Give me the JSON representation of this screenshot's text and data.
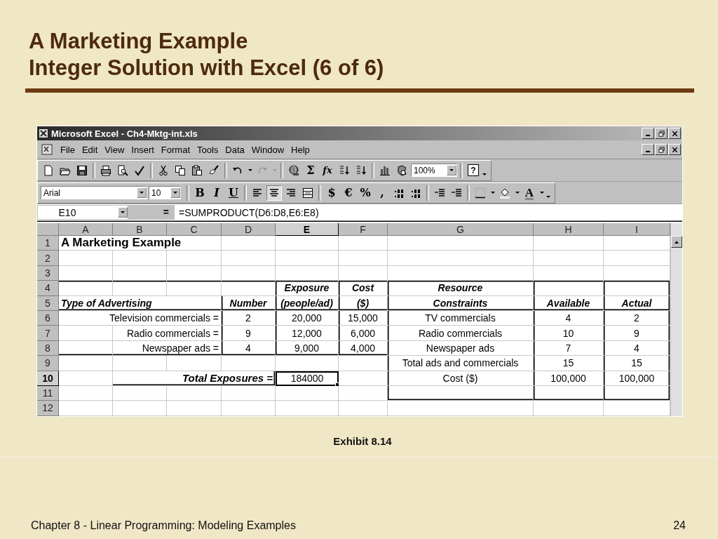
{
  "slide": {
    "title_lines": [
      "A Marketing Example",
      "Integer Solution with Excel (6 of 6)"
    ],
    "caption": "Exhibit 8.14",
    "footer": "Chapter 8 - Linear Programming:  Modeling Examples",
    "page": "24"
  },
  "window": {
    "title": "Microsoft Excel - Ch4-Mktg-int.xls"
  },
  "menu": [
    {
      "label": "File"
    },
    {
      "label": "Edit"
    },
    {
      "label": "View"
    },
    {
      "label": "Insert"
    },
    {
      "label": "Format"
    },
    {
      "label": "Tools"
    },
    {
      "label": "Data"
    },
    {
      "label": "Window"
    },
    {
      "label": "Help"
    }
  ],
  "standard_toolbar": [
    {
      "kind": "new"
    },
    {
      "kind": "open"
    },
    {
      "kind": "save"
    },
    {
      "kind": "separator"
    },
    {
      "kind": "print"
    },
    {
      "kind": "preview"
    },
    {
      "kind": "spelling"
    },
    {
      "kind": "separator"
    },
    {
      "kind": "cut"
    },
    {
      "kind": "copy"
    },
    {
      "kind": "paste"
    },
    {
      "kind": "painter"
    },
    {
      "kind": "separator"
    },
    {
      "kind": "undo"
    },
    {
      "kind": "caret"
    },
    {
      "kind": "redo"
    },
    {
      "kind": "caret-dim"
    },
    {
      "kind": "separator"
    },
    {
      "kind": "web"
    },
    {
      "kind": "glyph",
      "label": "Σ"
    },
    {
      "kind": "function",
      "label": "fx"
    },
    {
      "kind": "sort-asc"
    },
    {
      "kind": "sort-desc"
    },
    {
      "kind": "separator"
    },
    {
      "kind": "chart"
    },
    {
      "kind": "map"
    },
    {
      "kind": "zoom",
      "value": "100%"
    },
    {
      "kind": "separator"
    },
    {
      "kind": "help",
      "label": "?"
    },
    {
      "kind": "more"
    }
  ],
  "formatting_toolbar": [
    {
      "kind": "font",
      "value": "Arial"
    },
    {
      "kind": "size",
      "value": "10"
    },
    {
      "kind": "separator"
    },
    {
      "kind": "bold",
      "label": "B"
    },
    {
      "kind": "italic",
      "label": "I"
    },
    {
      "kind": "underline",
      "label": "U"
    },
    {
      "kind": "separator"
    },
    {
      "kind": "align-left",
      "selected": false
    },
    {
      "kind": "align-center",
      "selected": true
    },
    {
      "kind": "align-right",
      "selected": false
    },
    {
      "kind": "merge"
    },
    {
      "kind": "separator"
    },
    {
      "kind": "glyph",
      "label": "$"
    },
    {
      "kind": "glyph",
      "label": "€"
    },
    {
      "kind": "glyph",
      "label": "%"
    },
    {
      "kind": "glyph",
      "label": ","
    },
    {
      "kind": "inc-decimal"
    },
    {
      "kind": "dec-decimal"
    },
    {
      "kind": "separator"
    },
    {
      "kind": "outdent"
    },
    {
      "kind": "indent"
    },
    {
      "kind": "separator"
    },
    {
      "kind": "borders"
    },
    {
      "kind": "caret"
    },
    {
      "kind": "fill"
    },
    {
      "kind": "caret"
    },
    {
      "kind": "font-color",
      "label": "A"
    },
    {
      "kind": "caret"
    },
    {
      "kind": "more"
    }
  ],
  "formula_bar": {
    "cell": "E10",
    "equals": "=",
    "formula": "=SUMPRODUCT(D6:D8,E6:E8)"
  },
  "sheet": {
    "columns": [
      {
        "label": "A",
        "selected": false
      },
      {
        "label": "B",
        "selected": false
      },
      {
        "label": "C",
        "selected": false
      },
      {
        "label": "D",
        "selected": false
      },
      {
        "label": "E",
        "selected": true
      },
      {
        "label": "F",
        "selected": false
      },
      {
        "label": "G",
        "selected": false
      },
      {
        "label": "H",
        "selected": false
      },
      {
        "label": "I",
        "selected": false
      }
    ],
    "rows": [
      {
        "label": "1",
        "selected": false,
        "cells": {
          "A": {
            "text": "A Marketing Example",
            "kind": "title"
          }
        }
      },
      {
        "label": "2",
        "selected": false,
        "cells": {}
      },
      {
        "label": "3",
        "selected": false,
        "cells": {}
      },
      {
        "label": "4",
        "selected": false,
        "cells": {
          "E": {
            "text": "Exposure",
            "kind": "heading"
          },
          "F": {
            "text": "Cost",
            "kind": "heading"
          },
          "G": {
            "text": "Resource",
            "kind": "heading"
          }
        }
      },
      {
        "label": "5",
        "selected": false,
        "cells": {
          "A": {
            "text": "Type of Advertising",
            "kind": "heading-left"
          },
          "D": {
            "text": "Number",
            "kind": "heading"
          },
          "E": {
            "text": "(people/ad)",
            "kind": "heading"
          },
          "F": {
            "text": "($)",
            "kind": "heading"
          },
          "G": {
            "text": "Constraints",
            "kind": "heading"
          },
          "H": {
            "text": "Available",
            "kind": "heading"
          },
          "I": {
            "text": "Actual",
            "kind": "heading"
          }
        }
      },
      {
        "label": "6",
        "selected": false,
        "cells": {
          "C": {
            "text": "Television commercials =",
            "kind": "label"
          },
          "D": {
            "text": "2",
            "kind": "value"
          },
          "E": {
            "text": "20,000",
            "kind": "value"
          },
          "F": {
            "text": "15,000",
            "kind": "value"
          },
          "G": {
            "text": "TV commercials",
            "kind": "value"
          },
          "H": {
            "text": "4",
            "kind": "value"
          },
          "I": {
            "text": "2",
            "kind": "value"
          }
        }
      },
      {
        "label": "7",
        "selected": false,
        "cells": {
          "C": {
            "text": "Radio commercials =",
            "kind": "label"
          },
          "D": {
            "text": "9",
            "kind": "value"
          },
          "E": {
            "text": "12,000",
            "kind": "value"
          },
          "F": {
            "text": "6,000",
            "kind": "value"
          },
          "G": {
            "text": "Radio commercials",
            "kind": "value"
          },
          "H": {
            "text": "10",
            "kind": "value"
          },
          "I": {
            "text": "9",
            "kind": "value"
          }
        }
      },
      {
        "label": "8",
        "selected": false,
        "cells": {
          "C": {
            "text": "Newspaper ads =",
            "kind": "label"
          },
          "D": {
            "text": "4",
            "kind": "value"
          },
          "E": {
            "text": "9,000",
            "kind": "value"
          },
          "F": {
            "text": "4,000",
            "kind": "value"
          },
          "G": {
            "text": "Newspaper ads",
            "kind": "value"
          },
          "H": {
            "text": "7",
            "kind": "value"
          },
          "I": {
            "text": "4",
            "kind": "value"
          }
        }
      },
      {
        "label": "9",
        "selected": false,
        "cells": {
          "G": {
            "text": "Total ads and commercials",
            "kind": "value"
          },
          "H": {
            "text": "15",
            "kind": "value"
          },
          "I": {
            "text": "15",
            "kind": "value"
          }
        }
      },
      {
        "label": "10",
        "selected": true,
        "cells": {
          "D": {
            "text": "Total Exposures =",
            "kind": "total-label"
          },
          "E": {
            "text": "184000",
            "kind": "active"
          },
          "G": {
            "text": "Cost ($)",
            "kind": "value"
          },
          "H": {
            "text": "100,000",
            "kind": "value"
          },
          "I": {
            "text": "100,000",
            "kind": "value"
          }
        }
      },
      {
        "label": "11",
        "selected": false,
        "cells": {}
      },
      {
        "label": "12",
        "selected": false,
        "cells": {}
      }
    ]
  }
}
